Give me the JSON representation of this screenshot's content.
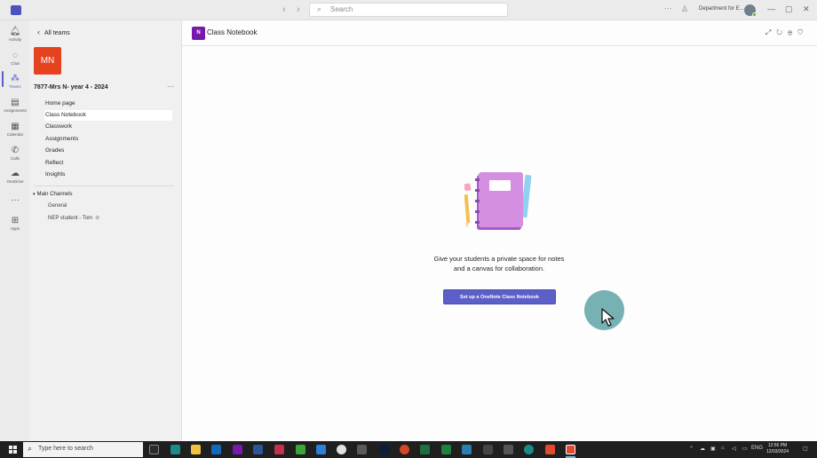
{
  "titlebar": {
    "search_placeholder": "Search",
    "org_name": "Department for E...",
    "back_arrow": "‹",
    "forward_arrow": "›",
    "more": "···",
    "minimize": "—",
    "maximize": "▢",
    "close": "✕"
  },
  "rail": {
    "items": [
      {
        "label": "Activity",
        "icon": "bell-icon"
      },
      {
        "label": "Chat",
        "icon": "chat-icon"
      },
      {
        "label": "Teams",
        "icon": "teams-icon"
      },
      {
        "label": "Assignments",
        "icon": "assignments-icon"
      },
      {
        "label": "Calendar",
        "icon": "calendar-icon"
      },
      {
        "label": "Calls",
        "icon": "phone-icon"
      },
      {
        "label": "OneDrive",
        "icon": "cloud-icon"
      },
      {
        "label": "Apps",
        "icon": "plus-icon"
      }
    ],
    "more": "···"
  },
  "team": {
    "back_label": "All teams",
    "initials": "MN",
    "name": "7877-Mrs N- year 4 - 2024",
    "more": "···",
    "nav": [
      "Home page",
      "Class Notebook",
      "Classwork",
      "Assignments",
      "Grades",
      "Reflect",
      "Insights"
    ],
    "selected_nav": "Class Notebook",
    "channels_header": "Main Channels",
    "channels": [
      "General",
      "NEP student - Tom"
    ]
  },
  "main": {
    "title": "Class Notebook",
    "app_badge": "N",
    "message_line1": "Give your students a private space for notes",
    "message_line2": "and a canvas for collaboration.",
    "button_label": "Set up a OneNote Class Notebook"
  },
  "taskbar": {
    "search_placeholder": "Type here to search",
    "time": "12:56 PM",
    "date": "12/03/2024",
    "lang": "ENG"
  },
  "colors": {
    "accent": "#5b5fc7",
    "team_avatar": "#e5421f",
    "onenote": "#7719aa",
    "cursor_halo": "#5ea3a6"
  }
}
